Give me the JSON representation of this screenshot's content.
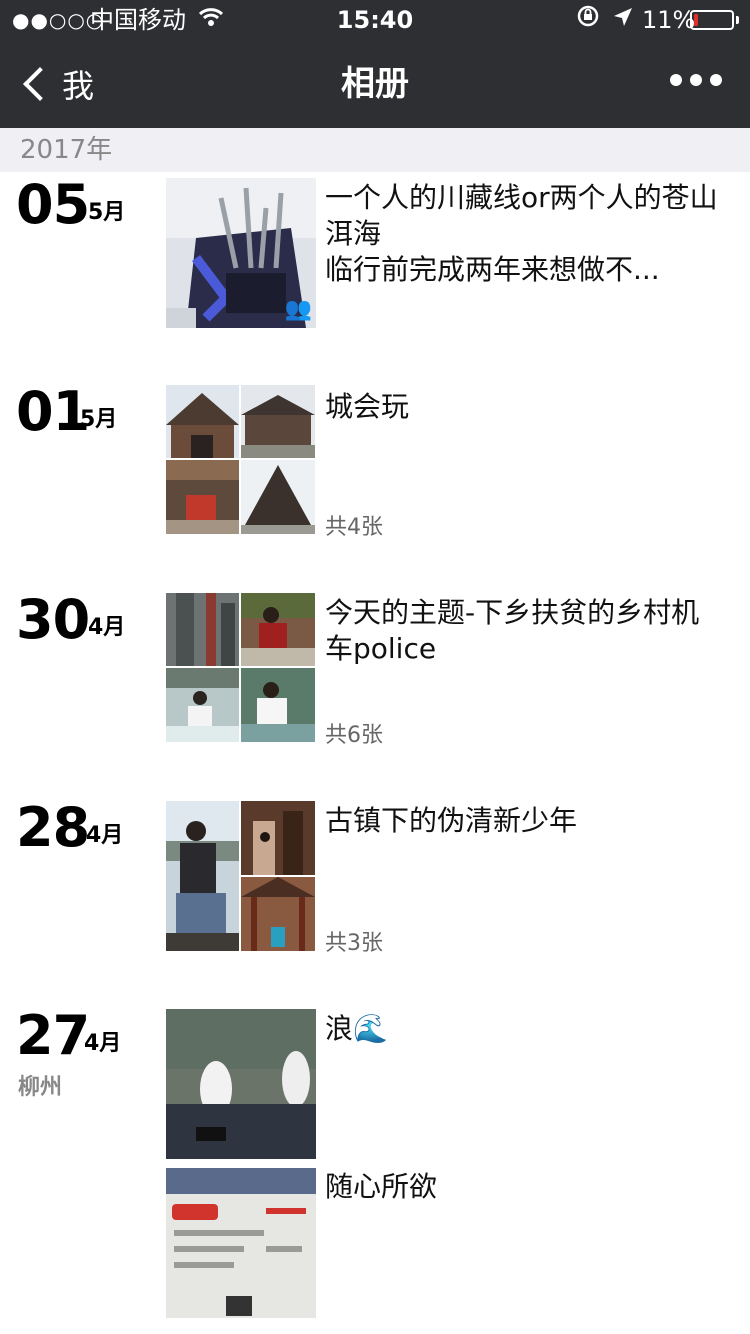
{
  "status": {
    "signal": "●●○○○",
    "carrier": "中国移动",
    "time": "15:40",
    "battery_pct": "11%",
    "battery_level": 0.11
  },
  "nav": {
    "back_label": "我",
    "title": "相册"
  },
  "year": "2017年",
  "entries": [
    {
      "day": "05",
      "month": "5月",
      "caption": "一个人的川藏线or两个人的苍山洱海\n临行前完成两年来想做不...",
      "count": ""
    },
    {
      "day": "01",
      "month": "5月",
      "caption": "城会玩",
      "count": "共4张"
    },
    {
      "day": "30",
      "month": "4月",
      "caption": "今天的主题-下乡扶贫的乡村机车police",
      "count": "共6张"
    },
    {
      "day": "28",
      "month": "4月",
      "caption": "古镇下的伪清新少年",
      "count": "共3张"
    },
    {
      "day": "27",
      "month": "4月",
      "location": "柳州",
      "caption": "浪🌊",
      "caption2": "随心所欲"
    }
  ],
  "colors": {
    "bar": "#2e2f33",
    "section_bg": "#efeff4",
    "battery_red": "#e0302a"
  }
}
